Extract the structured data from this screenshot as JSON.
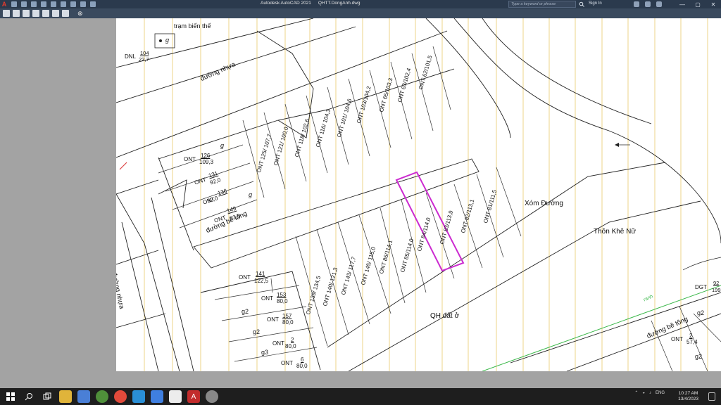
{
  "titlebar": {
    "app_name": "Autodesk AutoCAD 2021",
    "file_name": "QHTT.DongAnh.dwg",
    "search_placeholder": "Type a keyword or phrase",
    "signin_label": "Sign In",
    "minimize": "—",
    "maximize": "▢",
    "close": "✕"
  },
  "drawing": {
    "labels": {
      "tram_bien_the": "trạm biến thế",
      "g_top": "g",
      "dnl_code": "DNL",
      "dnl_num": "104",
      "dnl_area": "22,7",
      "duong_nhua_top": "đường nhựa",
      "duong_nhua_left": "đường nhựa",
      "duong_be_tong_mid": "đường bê tông",
      "duong_be_tong_right": "đường bê tông",
      "xom_duong": "Xóm Đường",
      "thon_khe_nu": "Thôn Khê Nữ",
      "qh_dat_o": "QH đất ở",
      "ranh": "ranh",
      "dgt": "DGT",
      "dgt_num": "92",
      "dgt_area": "199",
      "g_a": "g",
      "g_b": "g",
      "g2_a": "g2",
      "g2_b": "g2",
      "g3": "g3",
      "g2_right": "g2",
      "g2_right2": "g2"
    },
    "left_parcels": [
      {
        "code": "ONT",
        "num": "126",
        "area": "109,3"
      },
      {
        "code": "ONT",
        "num": "131",
        "area": "92,0"
      },
      {
        "code": "ONT",
        "num": "136",
        "area": "92,0"
      },
      {
        "code": "ONT",
        "num": "149",
        "area": "92,0"
      }
    ],
    "top_parcels": [
      "ONT 125/ 107,7",
      "ONT 121/ 100,0",
      "ONT 118/ 102,6",
      "ONT 116/ 104,3",
      "ONT 101/ 104,6",
      "ONT 103/104,2",
      "ONT 65/103,3",
      "ONT 63/102,4",
      "ONT 62/101,5"
    ],
    "mid_parcels": [
      "ONT 84/114,0",
      "ONT 83/113,9",
      "ONT 82/113,1",
      "ONT 81/111,5",
      "ONT 85/114,0",
      "ONT 86/114,1",
      "ONT 145/ 115,0",
      "ONT 143/ 117,7",
      "ONT 140/ 121,3",
      "ONT 139/ 134,5"
    ],
    "bottom_parcels": [
      {
        "code": "ONT",
        "num": "141",
        "area": "122,5"
      },
      {
        "code": "ONT",
        "num": "153",
        "area": "80,0"
      },
      {
        "code": "ONT",
        "num": "157",
        "area": "80,0"
      },
      {
        "code": "ONT",
        "num": "2",
        "area": "80,0"
      },
      {
        "code": "ONT",
        "num": "6",
        "area": "80,0"
      },
      {
        "code": "ONT",
        "num": "2",
        "area": "57,4"
      }
    ]
  },
  "taskbar": {
    "time": "10:27 AM",
    "date": "13/4/2023",
    "lang": "ENG",
    "apps": [
      "windows-start",
      "search",
      "task-view",
      "file-explorer",
      "store",
      "mail",
      "chrome",
      "edge",
      "zoom",
      "unikey",
      "autocad",
      "other"
    ]
  },
  "colors": {
    "highlight_parcel": "#cc2bd0",
    "grid_line": "#e8c96a",
    "green_line": "#3bb84a"
  }
}
